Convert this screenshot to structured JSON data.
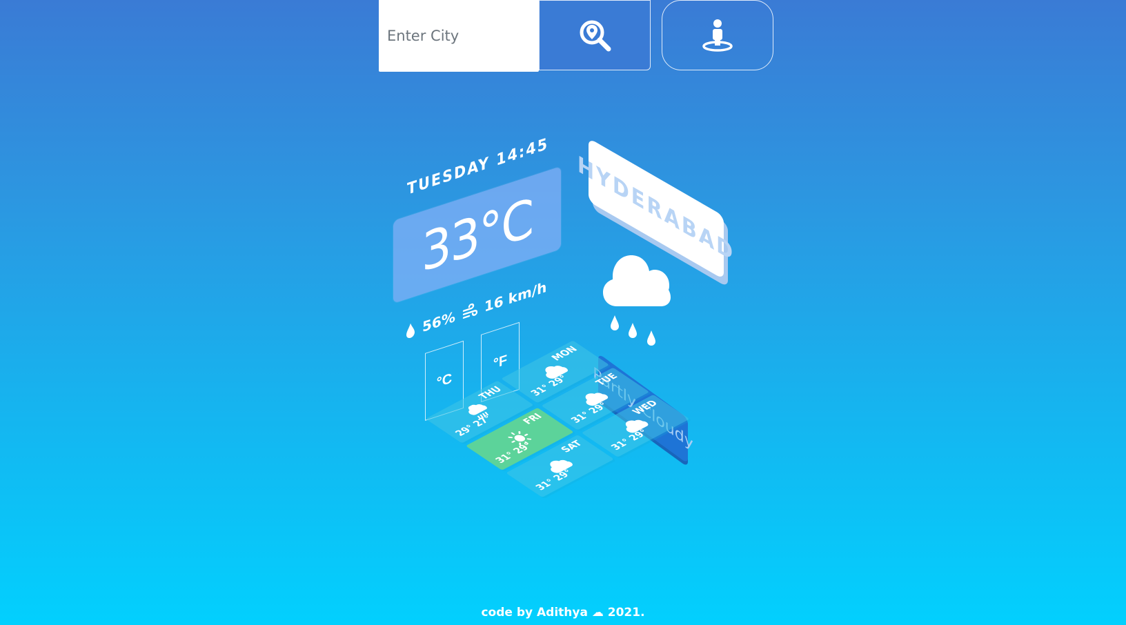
{
  "search": {
    "placeholder": "Enter City",
    "value": ""
  },
  "icons": {
    "search_button": "search-location-icon",
    "location_button": "street-view-icon"
  },
  "current": {
    "datetime": "TUESDAY 14:45",
    "temperature": "33°C",
    "humidity": "56%",
    "wind": "16 km/h",
    "humidity_icon": "droplet-icon",
    "wind_icon": "wind-icon"
  },
  "units": {
    "celsius": "°C",
    "fahrenheit": "°F"
  },
  "city": "HYDERABAD",
  "condition": "Partly Cloudy",
  "weather_icon": "cloud-rain-icon",
  "forecast": [
    {
      "day": "MON",
      "temps": "31° 29°",
      "icon": "cloud-icon"
    },
    {
      "day": "TUE",
      "temps": "31° 29°",
      "icon": "cloud-icon"
    },
    {
      "day": "WED",
      "temps": "31° 29°",
      "icon": "cloud-icon"
    },
    {
      "day": "THU",
      "temps": "29° 27°",
      "icon": "cloud-rain-icon"
    },
    {
      "day": "FRI",
      "temps": "31° 29°",
      "icon": "sun-icon"
    },
    {
      "day": "SAT",
      "temps": "31° 29°",
      "icon": "cloud-icon"
    }
  ],
  "colors": {
    "gradient_top": "#3a7bd5",
    "gradient_bottom": "#02d0fe",
    "temp_panel": "#81aff5",
    "condition_card": "#1e74d6",
    "forecast_active": "#5cd39a"
  },
  "footer": "code by Adithya ☁ 2021."
}
